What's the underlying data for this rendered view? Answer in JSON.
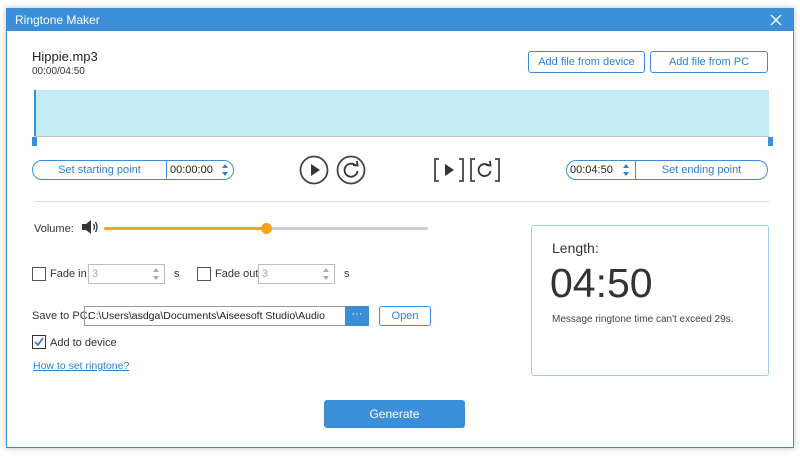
{
  "window": {
    "title": "Ringtone Maker"
  },
  "file": {
    "name": "Hippie.mp3",
    "time": "00:00/04:50"
  },
  "actions": {
    "add_device": "Add file from device",
    "add_pc": "Add file from PC"
  },
  "start": {
    "label": "Set starting point",
    "value": "00:00:00"
  },
  "end": {
    "label": "Set ending point",
    "value": "00:04:50"
  },
  "volume": {
    "label": "Volume:",
    "level_percent": 50
  },
  "fade_in": {
    "label": "Fade in",
    "value": "3",
    "unit": "s",
    "checked": false
  },
  "fade_out": {
    "label": "Fade out",
    "value": "3",
    "unit": "s",
    "checked": false
  },
  "save": {
    "label": "Save to PC:",
    "path": "C:\\Users\\asdga\\Documents\\Aiseesoft Studio\\Audio",
    "browse": "···",
    "open": "Open"
  },
  "add_to_device": {
    "label": "Add to device",
    "checked": true
  },
  "help_link": "How to set ringtone?",
  "length": {
    "label": "Length:",
    "value": "04:50",
    "message": "Message ringtone time can't exceed 29s."
  },
  "generate": "Generate",
  "colors": {
    "accent": "#3b8fd8",
    "wave": "#c3ecf4",
    "slider": "#f0a818"
  }
}
